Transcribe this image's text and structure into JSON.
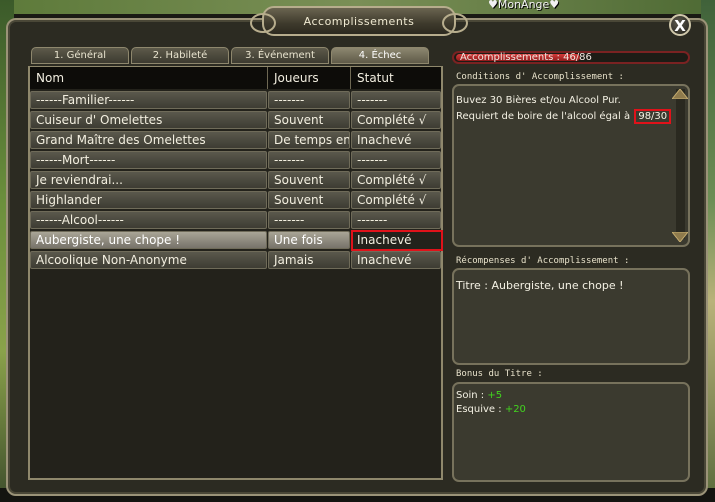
{
  "background": {
    "top_player_name": "♥MonAnge♥"
  },
  "window": {
    "title": "Accomplissements",
    "close_symbol": "X"
  },
  "tabs": [
    {
      "label": "1. Général",
      "active": false
    },
    {
      "label": "2. Habileté",
      "active": false
    },
    {
      "label": "3. Événement",
      "active": false
    },
    {
      "label": "4. Échec",
      "active": true
    }
  ],
  "table": {
    "headers": {
      "name": "Nom",
      "players": "Joueurs",
      "status": "Statut"
    },
    "rows": [
      {
        "name": "------Familier------",
        "players": "-------",
        "status": "-------"
      },
      {
        "name": "Cuiseur d' Omelettes",
        "players": "Souvent",
        "status": "Complété √"
      },
      {
        "name": "Grand Maître des Omelettes",
        "players": "De temps en",
        "status": "Inachevé"
      },
      {
        "name": "------Mort------",
        "players": "-------",
        "status": "-------"
      },
      {
        "name": "Je reviendrai...",
        "players": "Souvent",
        "status": "Complété √"
      },
      {
        "name": "Highlander",
        "players": "Souvent",
        "status": "Complété √"
      },
      {
        "name": "------Alcool------",
        "players": "-------",
        "status": "-------"
      },
      {
        "name": "Aubergiste, une chope !",
        "players": "Une fois",
        "status": "Inachevé"
      },
      {
        "name": "Alcoolique Non-Anonyme",
        "players": "Jamais",
        "status": "Inachevé"
      }
    ],
    "selected_row": 7
  },
  "progress": {
    "label": "Accomplissements : 46/86",
    "fraction": 0.535
  },
  "conditions": {
    "title": "Conditions d' Accomplissement :",
    "line1": "Buvez 30 Bières et/ou Alcool Pur.",
    "line2_prefix": "Requiert de boire de l'alcool égal à",
    "line2_value": "98/30"
  },
  "rewards": {
    "title": "Récompenses d' Accomplissement :",
    "text": "Titre : Aubergiste, une chope !"
  },
  "bonus": {
    "title": "Bonus du Titre :",
    "items": [
      {
        "label": "Soin :",
        "value": "+5"
      },
      {
        "label": "Esquive :",
        "value": "+20"
      }
    ]
  },
  "colors": {
    "highlight_red": "#e0121a",
    "bonus_green": "#42d31f",
    "progress_red": "#c92f2f"
  }
}
